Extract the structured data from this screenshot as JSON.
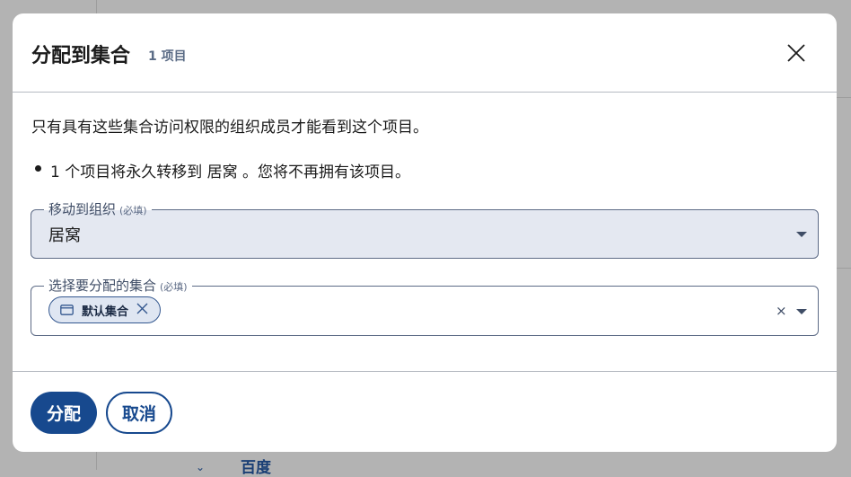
{
  "background": {
    "partial_label": "百度"
  },
  "dialog": {
    "title": "分配到集合",
    "item_count": "1 项目",
    "description": "只有具有这些集合访问权限的组织成员才能看到这个项目。",
    "bullet_text": "1 个项目将永久转移到 居窝 。您将不再拥有该项目。",
    "org_field": {
      "label": "移动到组织",
      "required": "(必填)",
      "value": "居窝"
    },
    "collection_field": {
      "label": "选择要分配的集合",
      "required": "(必填)",
      "chips": [
        {
          "label": "默认集合",
          "icon": "collection-icon"
        }
      ],
      "clear_symbol": "×"
    },
    "buttons": {
      "assign": "分配",
      "cancel": "取消"
    }
  },
  "colors": {
    "primary": "#17498e",
    "overlay": "#b3b3b3",
    "field_fill": "#e4e8f1"
  }
}
